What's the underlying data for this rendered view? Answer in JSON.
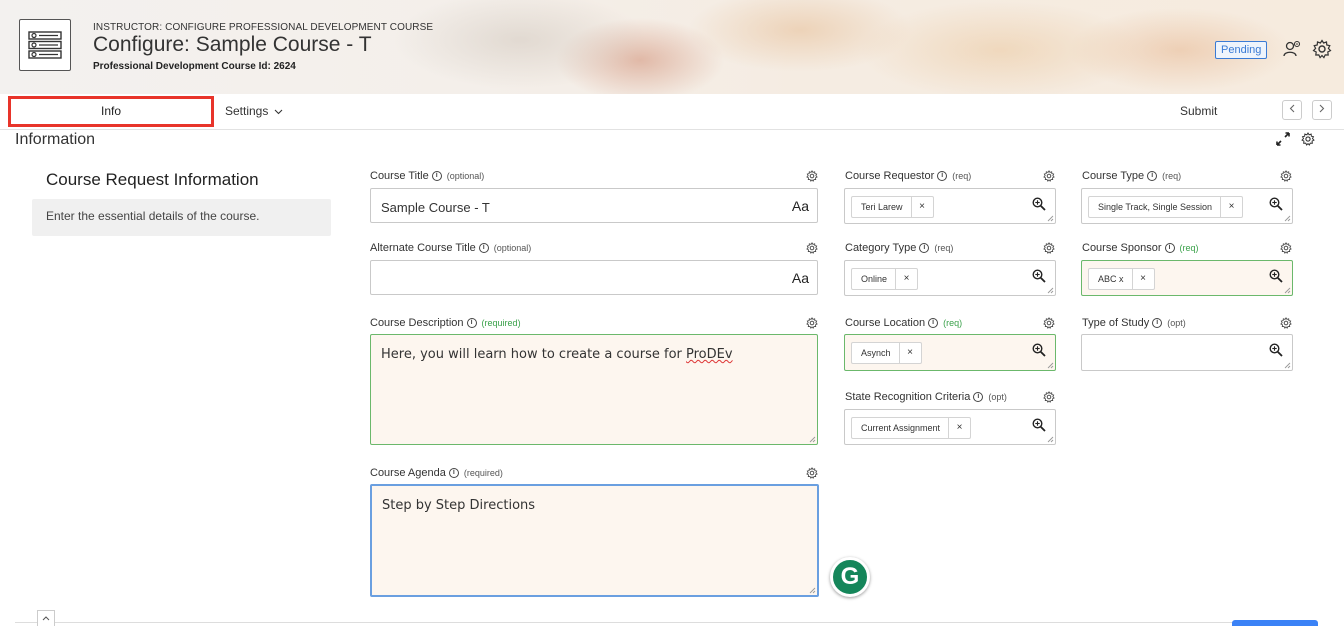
{
  "header": {
    "eyebrow": "INSTRUCTOR: CONFIGURE PROFESSIONAL DEVELOPMENT COURSE",
    "title": "Configure: Sample Course - T",
    "subtitle": "Professional Development Course Id: 2624",
    "status_badge": "Pending"
  },
  "tabs": {
    "info": "Info",
    "settings": "Settings",
    "submit": "Submit"
  },
  "section": {
    "heading": "Information"
  },
  "sidebar": {
    "title": "Course Request Information",
    "description": "Enter the essential details of the course."
  },
  "fields": {
    "course_title": {
      "label": "Course Title",
      "tag": "(optional)",
      "value": "Sample Course - T",
      "suffix": "Aa"
    },
    "alt_title": {
      "label": "Alternate Course Title",
      "tag": "(optional)",
      "value": "",
      "suffix": "Aa"
    },
    "description": {
      "label": "Course Description",
      "tag": "(required)",
      "value_before": "Here, you will learn how to create a course for ",
      "value_misspelled": "ProDEv"
    },
    "agenda": {
      "label": "Course Agenda",
      "tag": "(required)",
      "value": "Step by Step Directions"
    },
    "requestor": {
      "label": "Course Requestor",
      "tag": "(req)",
      "chip": "Teri Larew"
    },
    "category": {
      "label": "Category Type",
      "tag": "(req)",
      "chip": "Online"
    },
    "location": {
      "label": "Course Location",
      "tag": "(req)",
      "chip": "Asynch"
    },
    "recognition": {
      "label": "State Recognition Criteria",
      "tag": "(opt)",
      "chip": "Current Assignment"
    },
    "course_type": {
      "label": "Course Type",
      "tag": "(req)",
      "chip": "Single Track, Single Session"
    },
    "sponsor": {
      "label": "Course Sponsor",
      "tag": "(req)",
      "chip": "ABC x"
    },
    "study_type": {
      "label": "Type of Study",
      "tag": "(opt)"
    }
  },
  "icons": {
    "app": "list-settings-icon",
    "user": "user-gear-icon",
    "settings": "gear-icon",
    "expand": "expand-icon",
    "lookup": "magnify-plus-icon",
    "info": "info-icon",
    "grammarly": "grammarly-icon"
  },
  "colors": {
    "required_border": "#6bb86b",
    "focus_border": "#6a9fe0",
    "highlight_red": "#e8342a",
    "badge_blue": "#3a7bd5",
    "grammarly_green": "#15865a"
  },
  "grammarly_letter": "G",
  "chip_remove": "×"
}
